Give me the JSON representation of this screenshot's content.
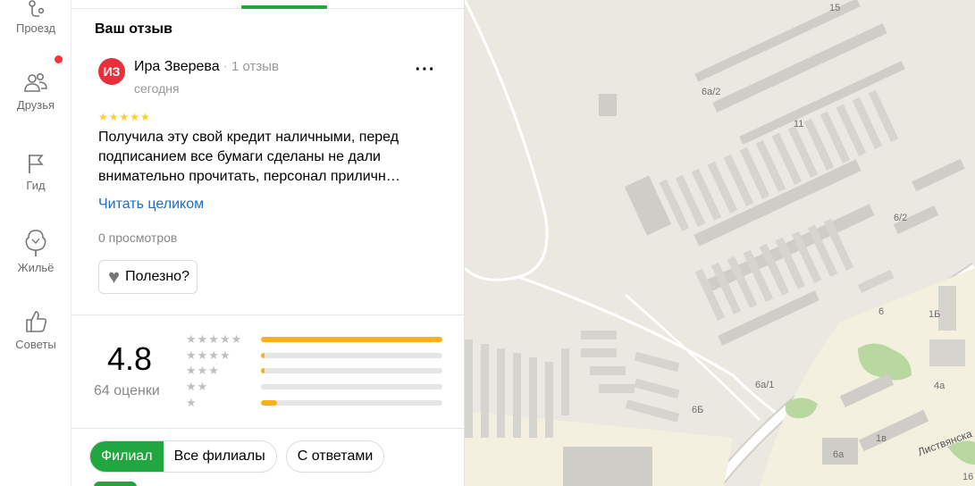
{
  "nav": {
    "items": [
      {
        "label": "Проезд",
        "icon": "route-icon"
      },
      {
        "label": "Друзья",
        "icon": "friends-icon"
      },
      {
        "label": "Гид",
        "icon": "flag-icon"
      },
      {
        "label": "Жильё",
        "icon": "house-icon"
      },
      {
        "label": "Советы",
        "icon": "thumbs-up-icon"
      }
    ],
    "notification_color": "#ff3333"
  },
  "review": {
    "section_title": "Ваш отзыв",
    "avatar_initials": "ИЗ",
    "author_name": "Ира Зверева",
    "author_reviews": "1 отзыв",
    "date": "сегодня",
    "rating_stars": 5,
    "text": "Получила эту свой кредит наличными, перед подписанием все бумаги сделаны не дали внимательно прочитать, персонал приличн…",
    "read_more": "Читать целиком",
    "views": "0 просмотров",
    "useful_label": "Полезно?"
  },
  "summary": {
    "rating": "4.8",
    "ratings_count": "64 оценки",
    "distribution": [
      {
        "stars": 5,
        "fraction": 1.0
      },
      {
        "stars": 4,
        "fraction": 0.02
      },
      {
        "stars": 3,
        "fraction": 0.02
      },
      {
        "stars": 2,
        "fraction": 0.0
      },
      {
        "stars": 1,
        "fraction": 0.09
      }
    ]
  },
  "filters": {
    "branch": "Филиал",
    "all_branches": "Все филиалы",
    "with_answers": "С ответами"
  },
  "map": {
    "labels": [
      "15",
      "6а/2",
      "11",
      "6/2",
      "6",
      "1Б",
      "6а/1",
      "6Б",
      "4а",
      "1в",
      "6а",
      "16"
    ],
    "street": "Листвянска"
  },
  "colors": {
    "accent": "#22a640",
    "link": "#1a6fc4",
    "star": "#fcb01c",
    "avatar": "#e8303a"
  }
}
